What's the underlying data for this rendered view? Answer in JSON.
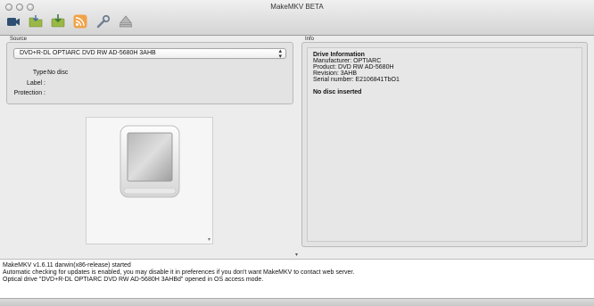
{
  "window": {
    "title": "MakeMKV BETA"
  },
  "toolbar": {
    "buttons": [
      {
        "icon": "video-camera-icon"
      },
      {
        "icon": "open-folder-icon"
      },
      {
        "icon": "save-to-disk-icon"
      },
      {
        "icon": "rss-stream-icon"
      },
      {
        "icon": "wrench-icon"
      },
      {
        "icon": "eject-icon"
      }
    ]
  },
  "source": {
    "group_label": "Source",
    "drive_selected": "DVD+R-DL OPTIARC DVD RW AD-5680H 3AHB",
    "type_label": "Type :",
    "type_value": "No disc",
    "label_label": "Label :",
    "label_value": "",
    "protection_label": "Protection :",
    "protection_value": ""
  },
  "info": {
    "group_label": "Info",
    "heading": "Drive Information",
    "manufacturer": "Manufacturer: OPTIARC",
    "product": "Product: DVD RW AD-5680H",
    "revision": "Revision: 3AHB",
    "serial": "Serial number: E2106841TbO1",
    "status": "No disc inserted"
  },
  "log": {
    "lines": [
      "MakeMKV v1.6.11 darwin(x86-release) started",
      "Automatic checking for updates is enabled, you may disable it in preferences if you don't want MakeMKV to contact web server.",
      "Optical drive \"DVD+R-DL OPTIARC DVD RW AD-5680H 3AHBd\" opened in OS access mode."
    ]
  }
}
